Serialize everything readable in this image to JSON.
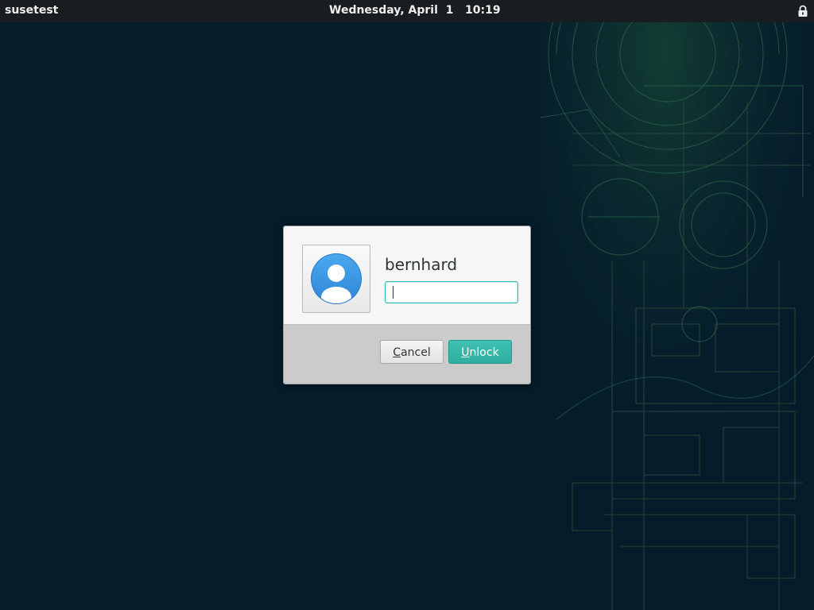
{
  "topbar": {
    "hostname": "susetest",
    "date": "Wednesday, April  1",
    "time": "10:19",
    "lock_icon": "lock-icon"
  },
  "dialog": {
    "username": "bernhard",
    "avatar_icon": "user-avatar-icon",
    "password_value": "",
    "cancel_mnemonic": "C",
    "cancel_rest": "ancel",
    "unlock_mnemonic": "U",
    "unlock_rest": "nlock"
  },
  "colors": {
    "background": "#051c2b",
    "topbar": "#1a1d1f",
    "accent": "#35b9ab",
    "avatar_blue": "#3b98e3"
  }
}
